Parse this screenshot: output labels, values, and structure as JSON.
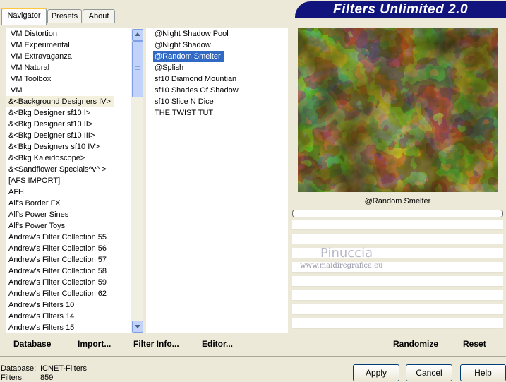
{
  "tabs": [
    {
      "label": "Navigator",
      "active": true
    },
    {
      "label": "Presets",
      "active": false
    },
    {
      "label": "About",
      "active": false
    }
  ],
  "app_title": "Filters Unlimited 2.0",
  "categories": [
    "VM Distortion",
    "VM Experimental",
    "VM Extravaganza",
    "VM Natural",
    "VM Toolbox",
    "VM",
    "&<Background Designers IV>",
    "&<Bkg Designer sf10 I>",
    "&<Bkg Designer sf10 II>",
    "&<Bkg Designer sf10 III>",
    "&<Bkg Designers sf10 IV>",
    "&<Bkg Kaleidoscope>",
    "&<Sandflower Specials^v^ >",
    "[AFS IMPORT]",
    "AFH",
    "Alf's Border FX",
    "Alf's Power Sines",
    "Alf's Power Toys",
    "Andrew's Filter Collection 55",
    "Andrew's Filter Collection 56",
    "Andrew's Filter Collection 57",
    "Andrew's Filter Collection 58",
    "Andrew's Filter Collection 59",
    "Andrew's Filter Collection 62",
    "Andrew's Filters 10",
    "Andrew's Filters 14",
    "Andrew's Filters 15"
  ],
  "selected_category_index": 6,
  "filters": [
    "@Night Shadow Pool",
    "@Night Shadow",
    "@Random Smelter",
    "@Splish",
    "sf10 Diamond Mountian",
    "sf10 Shades Of Shadow",
    "sf10 Slice N Dice",
    "THE TWIST TUT"
  ],
  "selected_filter_index": 2,
  "preview_filter_name": "@Random Smelter",
  "watermark": {
    "name": "Pinuccia",
    "url": "www.maidiregrafica.eu"
  },
  "bottom_links": {
    "database": "Database",
    "import": "Import...",
    "filter_info": "Filter Info...",
    "editor": "Editor...",
    "randomize": "Randomize",
    "reset": "Reset"
  },
  "status": {
    "database_label": "Database:",
    "database_value": "ICNET-Filters",
    "filters_label": "Filters:",
    "filters_value": "859"
  },
  "buttons": {
    "apply": "Apply",
    "cancel": "Cancel",
    "help": "Help"
  },
  "colors": {
    "banner": "#10147c",
    "selection": "#316ac5",
    "preview_dark": "#2b2508",
    "preview_gold": "#c9b441"
  }
}
